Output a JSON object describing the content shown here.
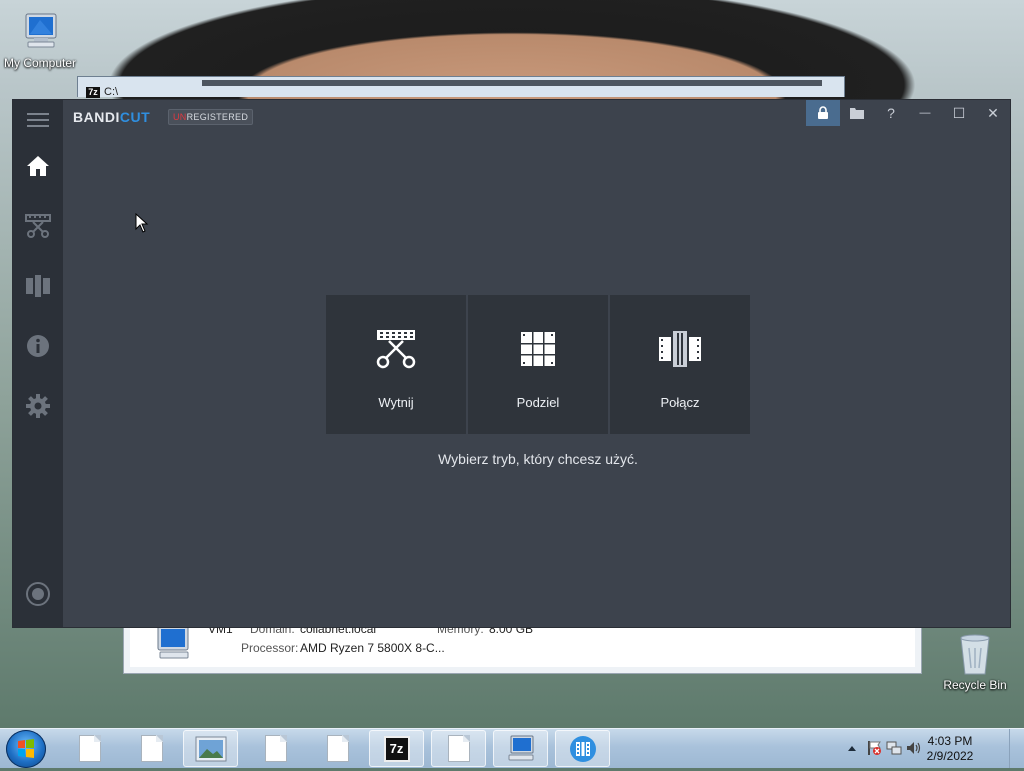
{
  "desktop": {
    "my_computer_label": "My Computer",
    "recycle_bin_label": "Recycle Bin"
  },
  "background_window": {
    "path_text": "C:\\",
    "computer_name": "VM1",
    "domain_label": "Domain:",
    "domain_value": "collabnet.local",
    "memory_label": "Memory:",
    "memory_value": "8.00 GB",
    "processor_label": "Processor:",
    "processor_value": "AMD Ryzen 7 5800X 8-C..."
  },
  "app": {
    "brand_main": "BANDI",
    "brand_accent": "CUT",
    "badge_un": "UN",
    "badge_rest": "REGISTERED",
    "colors": {
      "accent": "#2f8fe0",
      "unregistered": "#e2383f",
      "background": "#3d434d",
      "sidebar": "#2b3038",
      "tile": "#2f343b"
    },
    "sidebar": [
      {
        "name": "home",
        "icon": "home-icon"
      },
      {
        "name": "cut",
        "icon": "scissors-film-icon"
      },
      {
        "name": "join",
        "icon": "film-join-icon"
      },
      {
        "name": "info",
        "icon": "info-icon"
      },
      {
        "name": "settings",
        "icon": "gear-icon"
      },
      {
        "name": "record",
        "icon": "record-icon"
      }
    ],
    "window_controls": {
      "lock": "lock-icon",
      "folder": "folder-icon",
      "help": "?",
      "minimize": "—",
      "maximize": "☐",
      "close": "✕"
    },
    "modes": [
      {
        "label": "Wytnij",
        "icon": "scissors-film-icon"
      },
      {
        "label": "Podziel",
        "icon": "split-grid-icon"
      },
      {
        "label": "Połącz",
        "icon": "join-film-icon"
      }
    ],
    "hint": "Wybierz tryb, który chcesz użyć."
  },
  "taskbar": {
    "time": "4:03 PM",
    "date": "2/9/2022",
    "zip_label": "7z"
  }
}
